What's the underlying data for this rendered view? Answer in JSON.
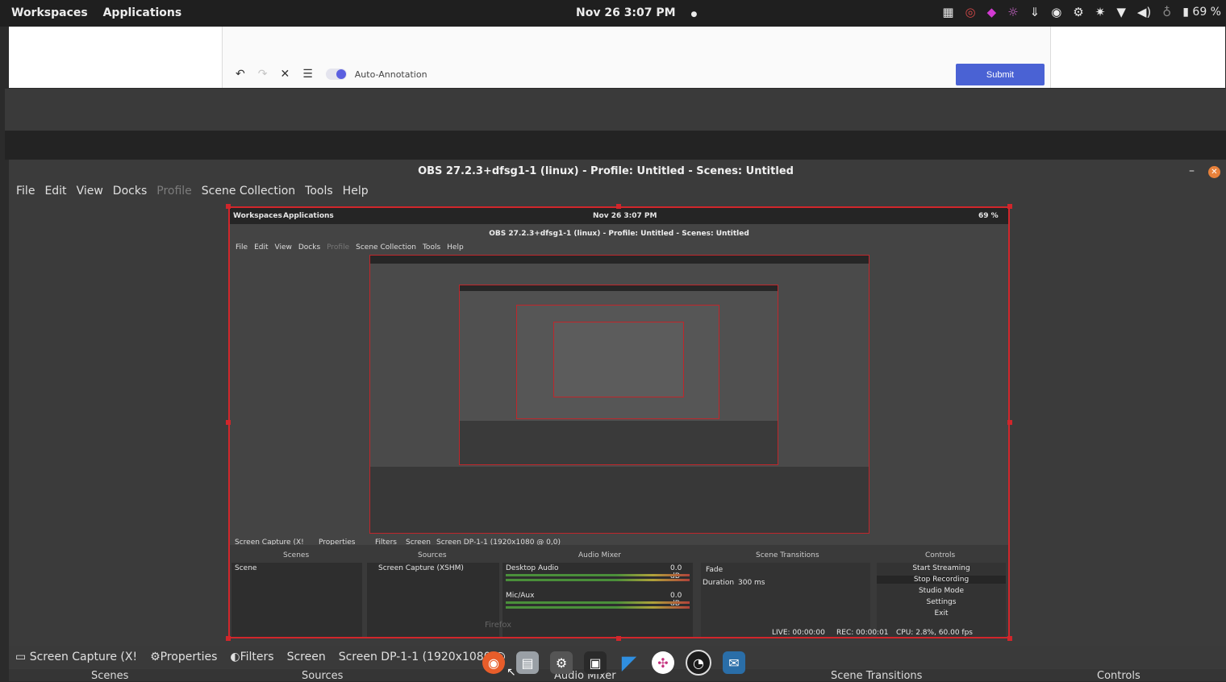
{
  "topbar": {
    "workspaces": "Workspaces",
    "applications": "Applications",
    "datetime": "Nov 26   3:07 PM",
    "dot": "●",
    "battery": "69 %"
  },
  "annotation": {
    "toggle_label": "Auto-Annotation",
    "submit_label": "Submit"
  },
  "obs": {
    "title": "OBS 27.2.3+dfsg1-1 (linux) - Profile: Untitled - Scenes: Untitled",
    "menu": [
      "File",
      "Edit",
      "View",
      "Docks",
      "Profile",
      "Scene Collection",
      "Tools",
      "Help"
    ],
    "nested": {
      "workspaces": "Workspaces",
      "applications": "Applications",
      "datetime": "Nov 26   3:07 PM",
      "battery": "69 %",
      "source_bar": [
        "Screen Capture (X!",
        "Properties",
        "Filters",
        "Screen",
        "Screen DP-1-1 (1920x1080 @ 0,0)"
      ],
      "scenes_header": "Scenes",
      "scene_item": "Scene",
      "sources_header": "Sources",
      "source_item": "Screen Capture (XSHM)",
      "mixer_header": "Audio Mixer",
      "desktop_audio": "Desktop Audio",
      "desktop_db": "0.0 dB",
      "mic_aux": "Mic/Aux",
      "mic_db": "0.0 dB",
      "transitions_header": "Scene Transitions",
      "fade": "Fade",
      "duration_label": "Duration",
      "duration_value": "300 ms",
      "controls_header": "Controls",
      "start_streaming": "Start Streaming",
      "stop_recording": "Stop Recording",
      "studio_mode": "Studio Mode",
      "settings": "Settings",
      "exit": "Exit",
      "live": "LIVE: 00:00:00",
      "rec": "REC: 00:00:01",
      "cpu": "CPU: 2.8%, 60.00 fps",
      "firefox_tooltip": "Firefox"
    },
    "source_bar": {
      "source": "Screen Capture (X!",
      "properties": "Properties",
      "filters": "Filters",
      "screen": "Screen",
      "screen_value": "Screen DP-1-1 (1920x1080 @"
    },
    "docks": {
      "scenes": "Scenes",
      "sources": "Sources",
      "mixer": "Audio Mixer",
      "transitions": "Scene Transitions",
      "controls": "Controls"
    }
  },
  "colors": {
    "accent": "#4a62d4",
    "selection_red": "#d1262b",
    "obs_bg": "#3b3b3b"
  }
}
